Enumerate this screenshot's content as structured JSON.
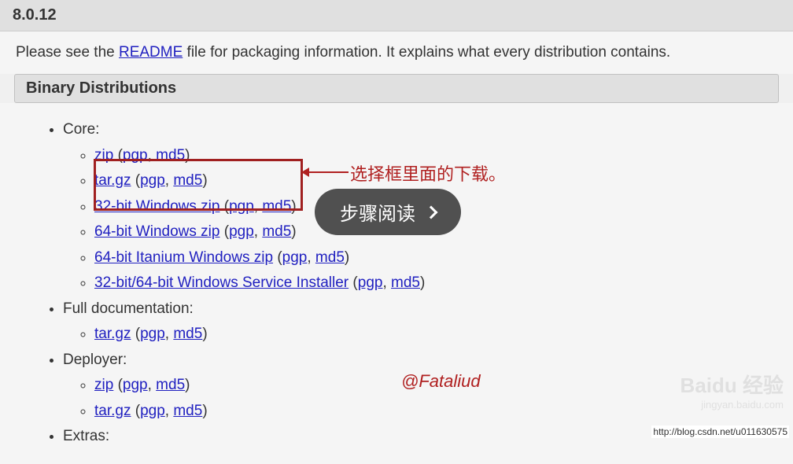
{
  "header": {
    "version": "8.0.12"
  },
  "description": {
    "pre": "Please see the ",
    "link": "README",
    "post": " file for packaging information. It explains what every distribution contains."
  },
  "section": {
    "title": "Binary Distributions"
  },
  "list": {
    "core": {
      "label": "Core:",
      "items": [
        {
          "name": "zip",
          "pgp": "pgp",
          "md5": "md5"
        },
        {
          "name": "tar.gz",
          "pgp": "pgp",
          "md5": "md5"
        },
        {
          "name": "32-bit Windows zip",
          "pgp": "pgp",
          "md5": "md5"
        },
        {
          "name": "64-bit Windows zip",
          "pgp": "pgp",
          "md5": "md5"
        },
        {
          "name": "64-bit Itanium Windows zip",
          "pgp": "pgp",
          "md5": "md5"
        },
        {
          "name": "32-bit/64-bit Windows Service Installer",
          "pgp": "pgp",
          "md5": "md5"
        }
      ]
    },
    "fulldoc": {
      "label": "Full documentation:",
      "items": [
        {
          "name": "tar.gz",
          "pgp": "pgp",
          "md5": "md5"
        }
      ]
    },
    "deployer": {
      "label": "Deployer:",
      "items": [
        {
          "name": "zip",
          "pgp": "pgp",
          "md5": "md5"
        },
        {
          "name": "tar.gz",
          "pgp": "pgp",
          "md5": "md5"
        }
      ]
    },
    "extras": {
      "label": "Extras:"
    }
  },
  "annotation": {
    "red_text": "选择框里面的下载。"
  },
  "badge": {
    "text": "步骤阅读"
  },
  "watermark": {
    "author": "@Fataliud",
    "baidu": "Baidu 经验",
    "baidu_sub": "jingyan.baidu.com"
  },
  "source_url": "http://blog.csdn.net/u011630575",
  "punct": {
    "open": " (",
    "comma": ", ",
    "close": ")"
  }
}
